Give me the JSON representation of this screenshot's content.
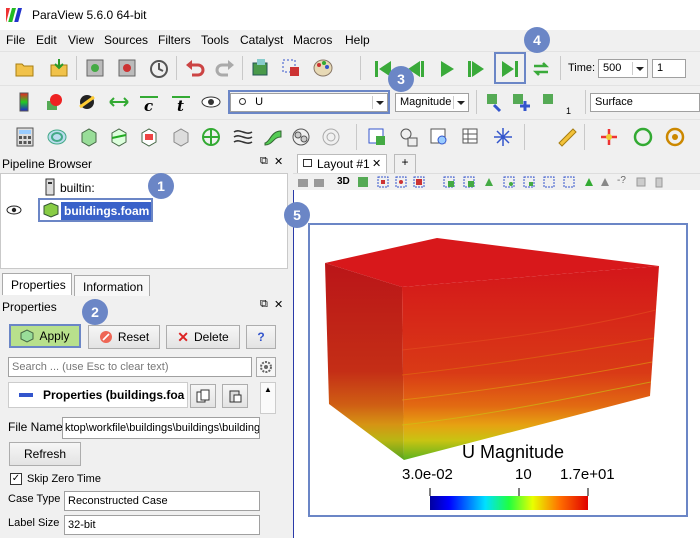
{
  "app": {
    "title": "ParaView 5.6.0 64-bit"
  },
  "menu": [
    "File",
    "Edit",
    "View",
    "Sources",
    "Filters",
    "Tools",
    "Catalyst",
    "Macros",
    "Help"
  ],
  "time": {
    "label": "Time:",
    "value": "500",
    "step": "1"
  },
  "toolbar2": {
    "variable": "U",
    "component": "Magnitude",
    "representation": "Surface",
    "counter": "1"
  },
  "pipeline": {
    "header": "Pipeline Browser",
    "items": [
      {
        "label": "builtin:"
      },
      {
        "label": "buildings.foam"
      }
    ]
  },
  "tabs": {
    "properties": "Properties",
    "information": "Information"
  },
  "properties_panel": {
    "header": "Properties",
    "apply": "Apply",
    "reset": "Reset",
    "delete": "Delete",
    "help": "?",
    "search_placeholder": "Search ... (use Esc to clear text)",
    "section_title": "Properties (buildings.foa",
    "file_name_label": "File Name",
    "file_name_value": "ktop\\workfile\\buildings\\buildings\\buildings",
    "refresh": "Refresh",
    "skip_zero_time": "Skip Zero Time",
    "case_type_label": "Case Type",
    "case_type_value": "Reconstructed Case",
    "label_size_label": "Label Size",
    "label_size_value": "32-bit"
  },
  "layout_tab": {
    "label": "Layout #1",
    "close": "✕",
    "add": "+"
  },
  "view_toolbar": {
    "mode": "3D"
  },
  "colorbar": {
    "title": "U Magnitude",
    "min": "3.0e-02",
    "mid": "10",
    "max": "1.7e+01"
  },
  "callouts": [
    "1",
    "2",
    "3",
    "4",
    "5"
  ],
  "colors": {
    "accent": "#6b86c6",
    "selection": "#3a62c9",
    "apply_green": "#b8e08c"
  }
}
